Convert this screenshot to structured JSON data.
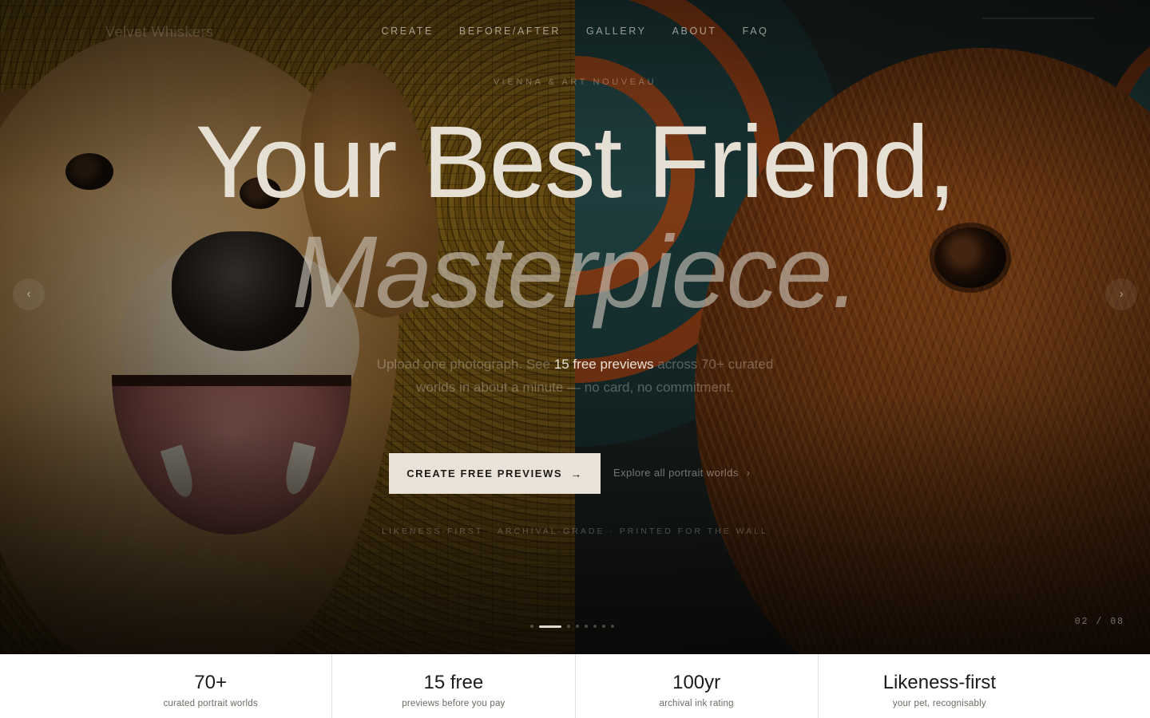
{
  "brand": {
    "name": "Velvet Whiskers"
  },
  "nav": {
    "items": [
      "CREATE",
      "BEFORE/AFTER",
      "GALLERY",
      "ABOUT",
      "FAQ"
    ]
  },
  "hero": {
    "eyebrow": "VIENNA & ART NOUVEAU",
    "headline_line1": "Your Best Friend,",
    "headline_line2": "Masterpiece.",
    "subcopy_pre": "Upload one photograph. See ",
    "subcopy_highlight": "15 free previews",
    "subcopy_post": " across 70+ curated worlds in about a minute — no card, no commitment.",
    "cta_label": "CREATE FREE PREVIEWS",
    "cta_icon": "arrow-right-icon",
    "explore_label": "Explore all portrait worlds",
    "explore_icon": "chevron-right-icon",
    "tagline": "LIKENESS-FIRST  ·  ARCHIVAL-GRADE  ·  PRINTED FOR THE WALL",
    "prev_icon": "chevron-left-icon",
    "next_icon": "chevron-right-icon",
    "slide_counter": "02 / 08",
    "slide_total": 8,
    "slide_active_index": 1
  },
  "stats": [
    {
      "value": "70+",
      "label": "curated portrait worlds"
    },
    {
      "value": "15 free",
      "label": "previews before you pay"
    },
    {
      "value": "100yr",
      "label": "archival ink rating"
    },
    {
      "value": "Likeness-first",
      "label": "your pet, recognisably"
    }
  ],
  "colors": {
    "cta_background": "#e8e2d8",
    "cta_text": "#1d1a16",
    "stats_background": "#ffffff"
  }
}
